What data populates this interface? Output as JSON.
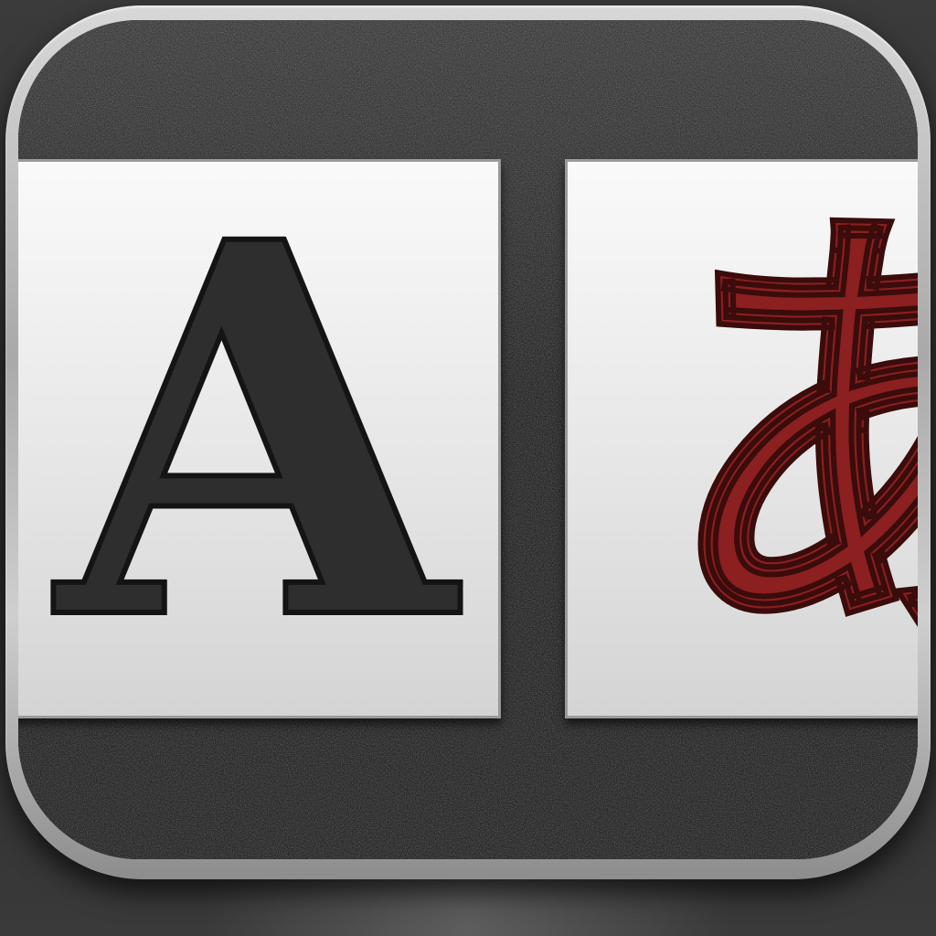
{
  "icon": {
    "left_glyph": "A",
    "right_glyph": "あ",
    "colors": {
      "left_glyph": "#2e2e2e",
      "right_glyph": "#8c1f1f",
      "card": "#e6e6e6",
      "frame": "#b0b0b0",
      "face": "#262626"
    }
  }
}
